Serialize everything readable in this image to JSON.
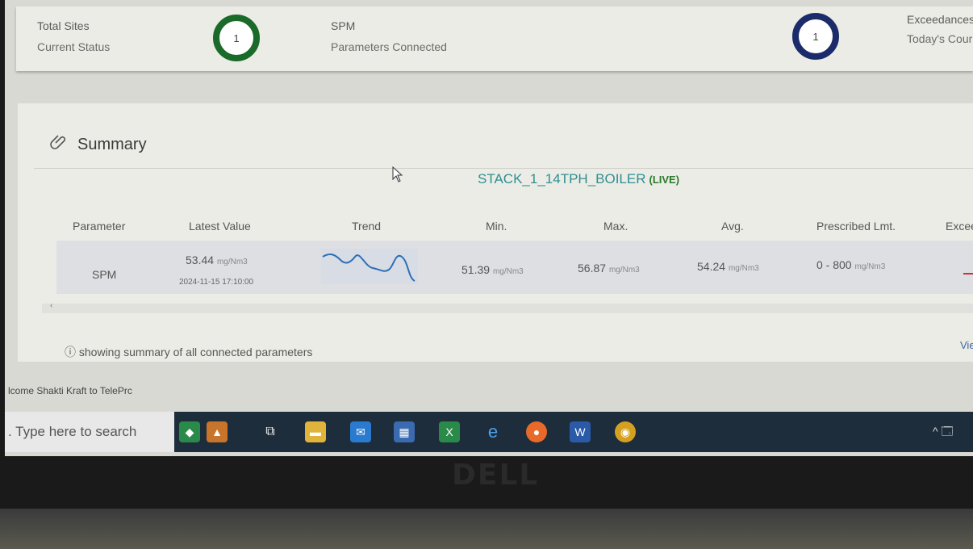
{
  "status_strip": {
    "total_sites_label": "Total Sites",
    "current_status_label": "Current Status",
    "total_sites_count": "1",
    "param_name": "SPM",
    "param_sub": "Parameters Connected",
    "exceedances_count": "1",
    "exceedances_label": "Exceedances",
    "todays_count_label": "Today's Cour",
    "colors": {
      "green_ring": "#1a6a2a",
      "navy_ring": "#1c2c6a"
    }
  },
  "summary": {
    "title": "Summary",
    "title_icon": "paperclip-icon",
    "device_name": "STACK_1_14TPH_BOILER",
    "live_label": "(LIVE)",
    "columns": [
      "Parameter",
      "Latest Value",
      "Trend",
      "Min.",
      "Max.",
      "Avg.",
      "Prescribed Lmt.",
      "Excee"
    ],
    "row": {
      "parameter": "SPM",
      "latest_value": "53.44",
      "latest_unit": "mg/Nm3",
      "timestamp": "2024-11-15 17:10:00",
      "min": "51.39",
      "min_unit": "mg/Nm3",
      "max": "56.87",
      "max_unit": "mg/Nm3",
      "avg": "54.24",
      "avg_unit": "mg/Nm3",
      "limit": "0 - 800",
      "limit_unit": "mg/Nm3"
    },
    "scroll_left": "‹",
    "note_icon": "ⓘ",
    "note": "showing summary of all connected parameters",
    "view_link": "Vie"
  },
  "browser_status": "lcome Shakti Kraft to TelePrc",
  "taskbar": {
    "search_placeholder": ". Type here to search",
    "icons": [
      "peacock-icon",
      "diya-icon",
      "task-view-icon",
      "file-explorer-icon",
      "mail-icon",
      "store-icon",
      "excel-icon",
      "edge-icon",
      "firefox-icon",
      "word-icon",
      "chrome-icon"
    ],
    "tray_glyph": "^ 🗔"
  },
  "monitor_brand": "DELL"
}
